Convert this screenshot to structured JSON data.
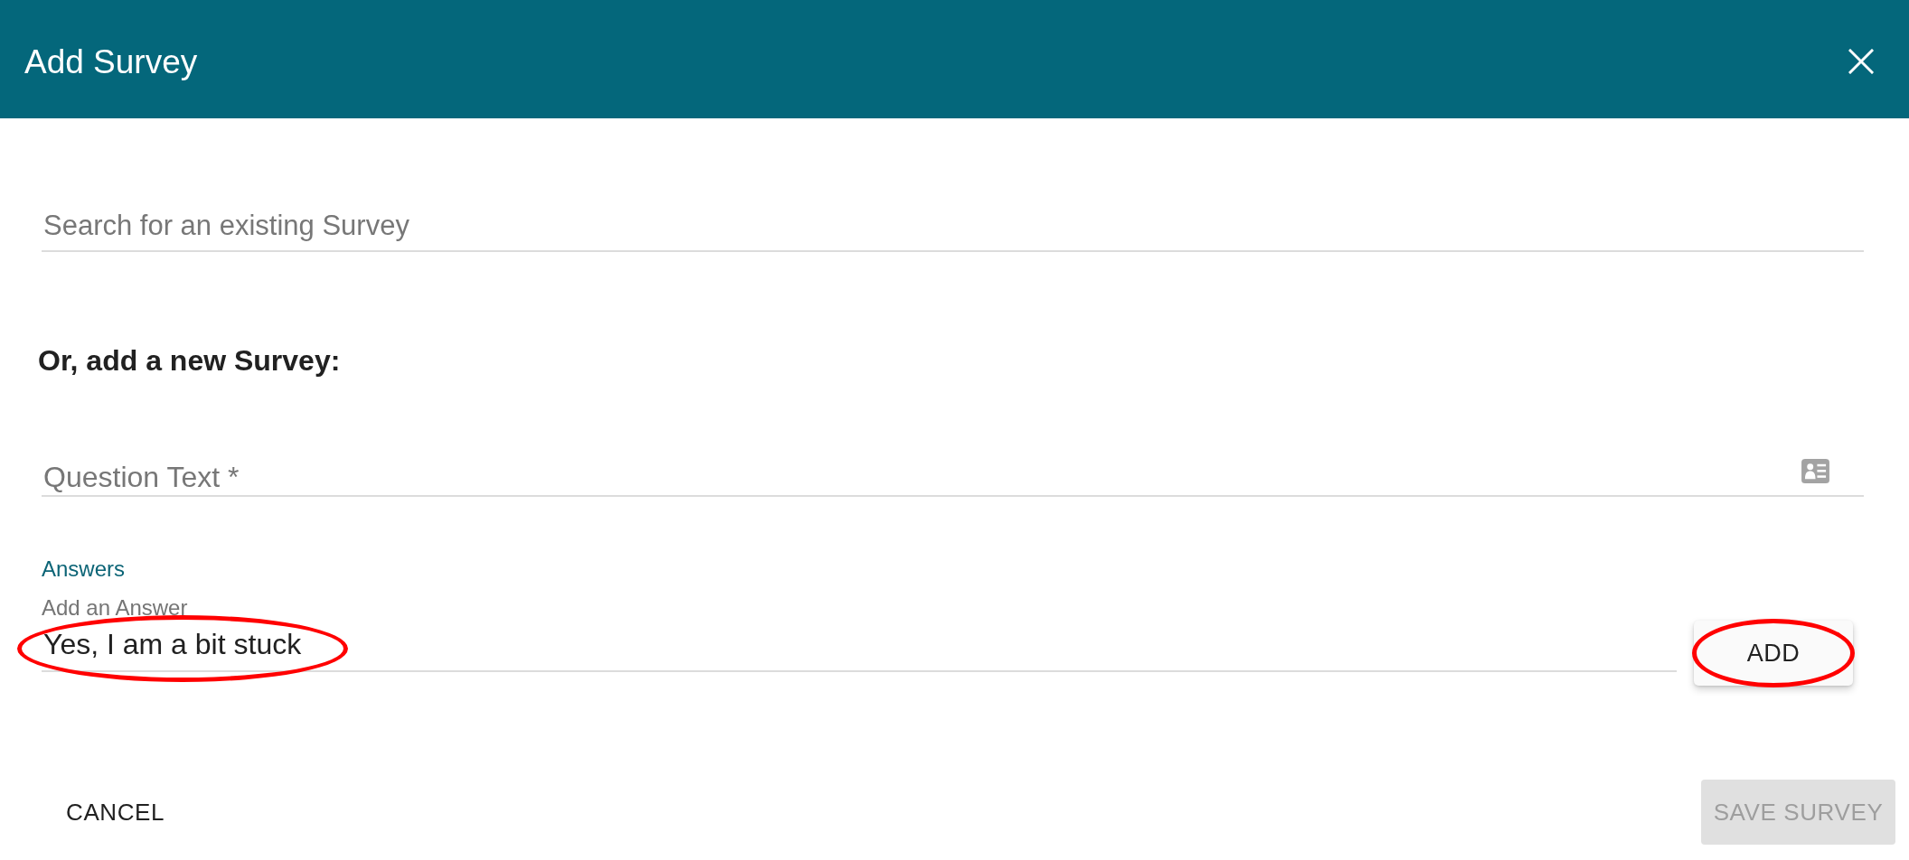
{
  "dialog": {
    "title": "Add Survey"
  },
  "search": {
    "placeholder": "Search for an existing Survey"
  },
  "new_survey": {
    "heading": "Or, add a new Survey:",
    "question": {
      "placeholder": "Question Text *"
    },
    "answers": {
      "label": "Answers",
      "answer": {
        "label": "Add an Answer",
        "value": "Yes, I am a bit stuck",
        "highlighted": true
      },
      "add_button": {
        "label": "ADD",
        "highlighted": true
      }
    }
  },
  "actions": [
    {
      "label": "CANCEL",
      "disabled": false
    },
    {
      "label": "SAVE SURVEY",
      "disabled": true
    }
  ]
}
